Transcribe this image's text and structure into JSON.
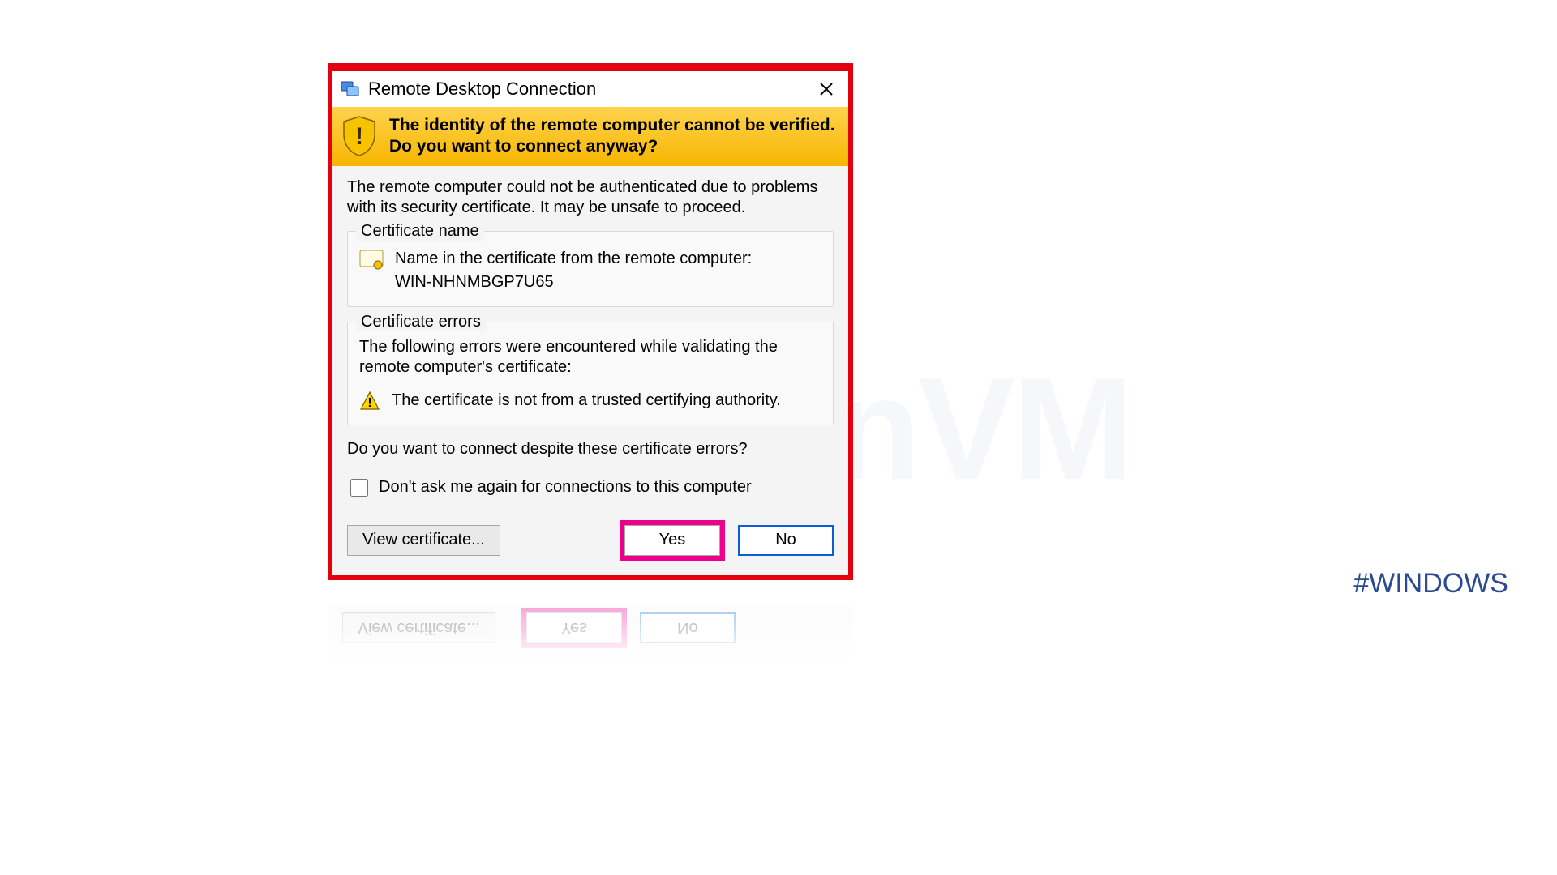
{
  "watermark": "NeuronVM",
  "hashtag": "#WINDOWS",
  "dialog": {
    "title": "Remote Desktop Connection",
    "banner": "The identity of the remote computer cannot be verified. Do you want to connect anyway?",
    "intro": "The remote computer could not be authenticated due to problems with its security certificate. It may be unsafe to proceed.",
    "cert_name_legend": "Certificate name",
    "cert_name_label": "Name in the certificate from the remote computer:",
    "cert_name_value": "WIN-NHNMBGP7U65",
    "cert_errors_legend": "Certificate errors",
    "cert_errors_intro": "The following errors were encountered while validating the remote computer's certificate:",
    "cert_error_1": "The certificate is not from a trusted certifying authority.",
    "question": "Do you want to connect despite these certificate errors?",
    "checkbox_label": "Don't ask me again for connections to this computer",
    "buttons": {
      "view": "View certificate...",
      "yes": "Yes",
      "no": "No"
    }
  }
}
